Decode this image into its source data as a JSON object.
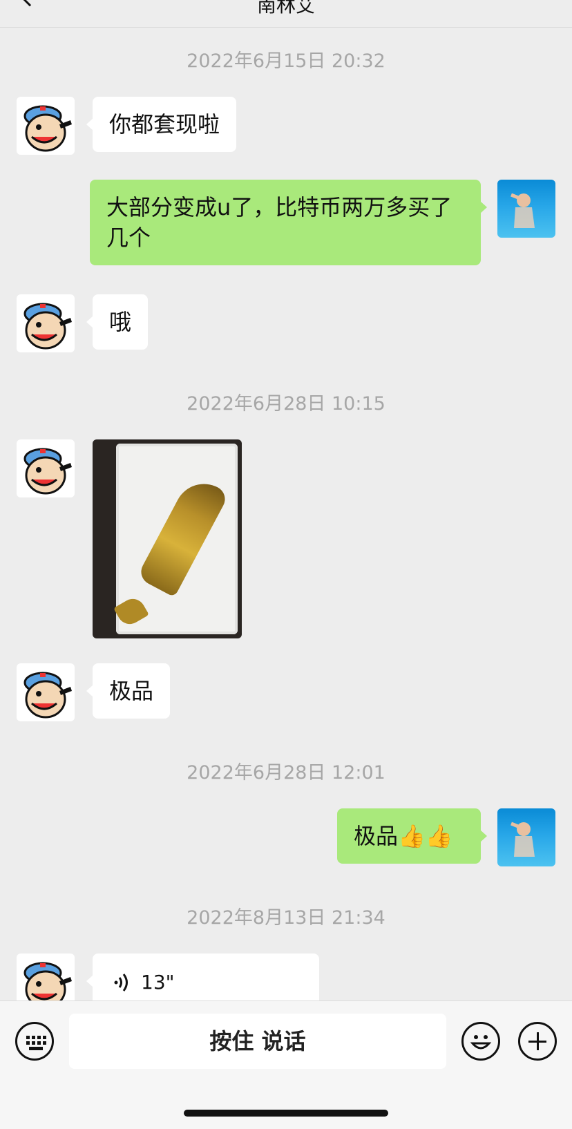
{
  "header": {
    "title": "南林艾",
    "back_icon": "chevron-left-icon"
  },
  "messages": [
    {
      "timestamp": "2022年6月15日 20:32"
    },
    {
      "side": "in",
      "text": "你都套现啦"
    },
    {
      "side": "out",
      "text": "大部分变成u了，比特币两万多买了几个"
    },
    {
      "side": "in",
      "text": "哦"
    },
    {
      "timestamp": "2022年6月28日 10:15"
    },
    {
      "side": "in",
      "type": "image",
      "text": ""
    },
    {
      "side": "in",
      "text": "极品"
    },
    {
      "timestamp": "2022年6月28日 12:01"
    },
    {
      "side": "out",
      "text": "极品👍👍"
    },
    {
      "timestamp": "2022年8月13日 21:34"
    },
    {
      "side": "in",
      "type": "voice",
      "duration": "13\""
    }
  ],
  "input_bar": {
    "hold_to_talk": "按住 说话",
    "keyboard_icon": "keyboard-icon",
    "emoji_icon": "emoji-icon",
    "plus_icon": "plus-icon"
  },
  "colors": {
    "background": "#ededed",
    "outgoing_bubble": "#a9e97b",
    "incoming_bubble": "#ffffff"
  }
}
